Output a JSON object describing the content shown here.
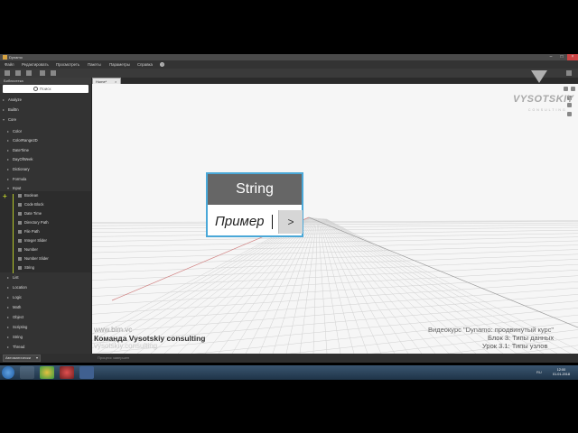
{
  "window": {
    "title": "Dynamo"
  },
  "menu": [
    "Файл",
    "Редактировать",
    "Просмотреть",
    "Пакеты",
    "Параметры",
    "Справка"
  ],
  "library": {
    "title": "Библиотека",
    "search_placeholder": "Поиск",
    "top_items": [
      "Analyze",
      "BuiltIn",
      "Core"
    ],
    "core_items": [
      "Color",
      "ColorRange2D",
      "DateTime",
      "DayOfWeek",
      "Dictionary",
      "Formula",
      "Input"
    ],
    "input_items": [
      "Boolean",
      "Code Block",
      "Date Time",
      "Directory Path",
      "File Path",
      "Integer Slider",
      "Number",
      "Number Slider",
      "String"
    ],
    "more_items": [
      "List",
      "Location",
      "Logic",
      "Math",
      "Object",
      "Scripting",
      "String",
      "Thread"
    ]
  },
  "workspace": {
    "tab_label": "Home*",
    "tab_close": "×"
  },
  "node": {
    "title": "String",
    "value": "Пример",
    "button": ">"
  },
  "watermark": {
    "logo": "VYSOTSKIY",
    "sub": "CONSULTING"
  },
  "captions": {
    "site": "www.bim.vc",
    "team": "Команда Vysotskiy consulting",
    "site2": "vysotskiy.consulting",
    "course": "Видеокурс \"Dynamo: продвинутый курс\"",
    "block": "Блок 3: Типы данных",
    "lesson": "Урок 3.1: Типы узлов"
  },
  "statusbar": {
    "run_mode": "Автоматически",
    "run_status": "Процесс завершен"
  },
  "tray": {
    "lang": "RU",
    "time": "12:00",
    "date": "01.01.2018"
  },
  "colors": {
    "node_border": "#4aa8d8",
    "node_header": "#666666",
    "accent_green": "#b5c72a"
  }
}
